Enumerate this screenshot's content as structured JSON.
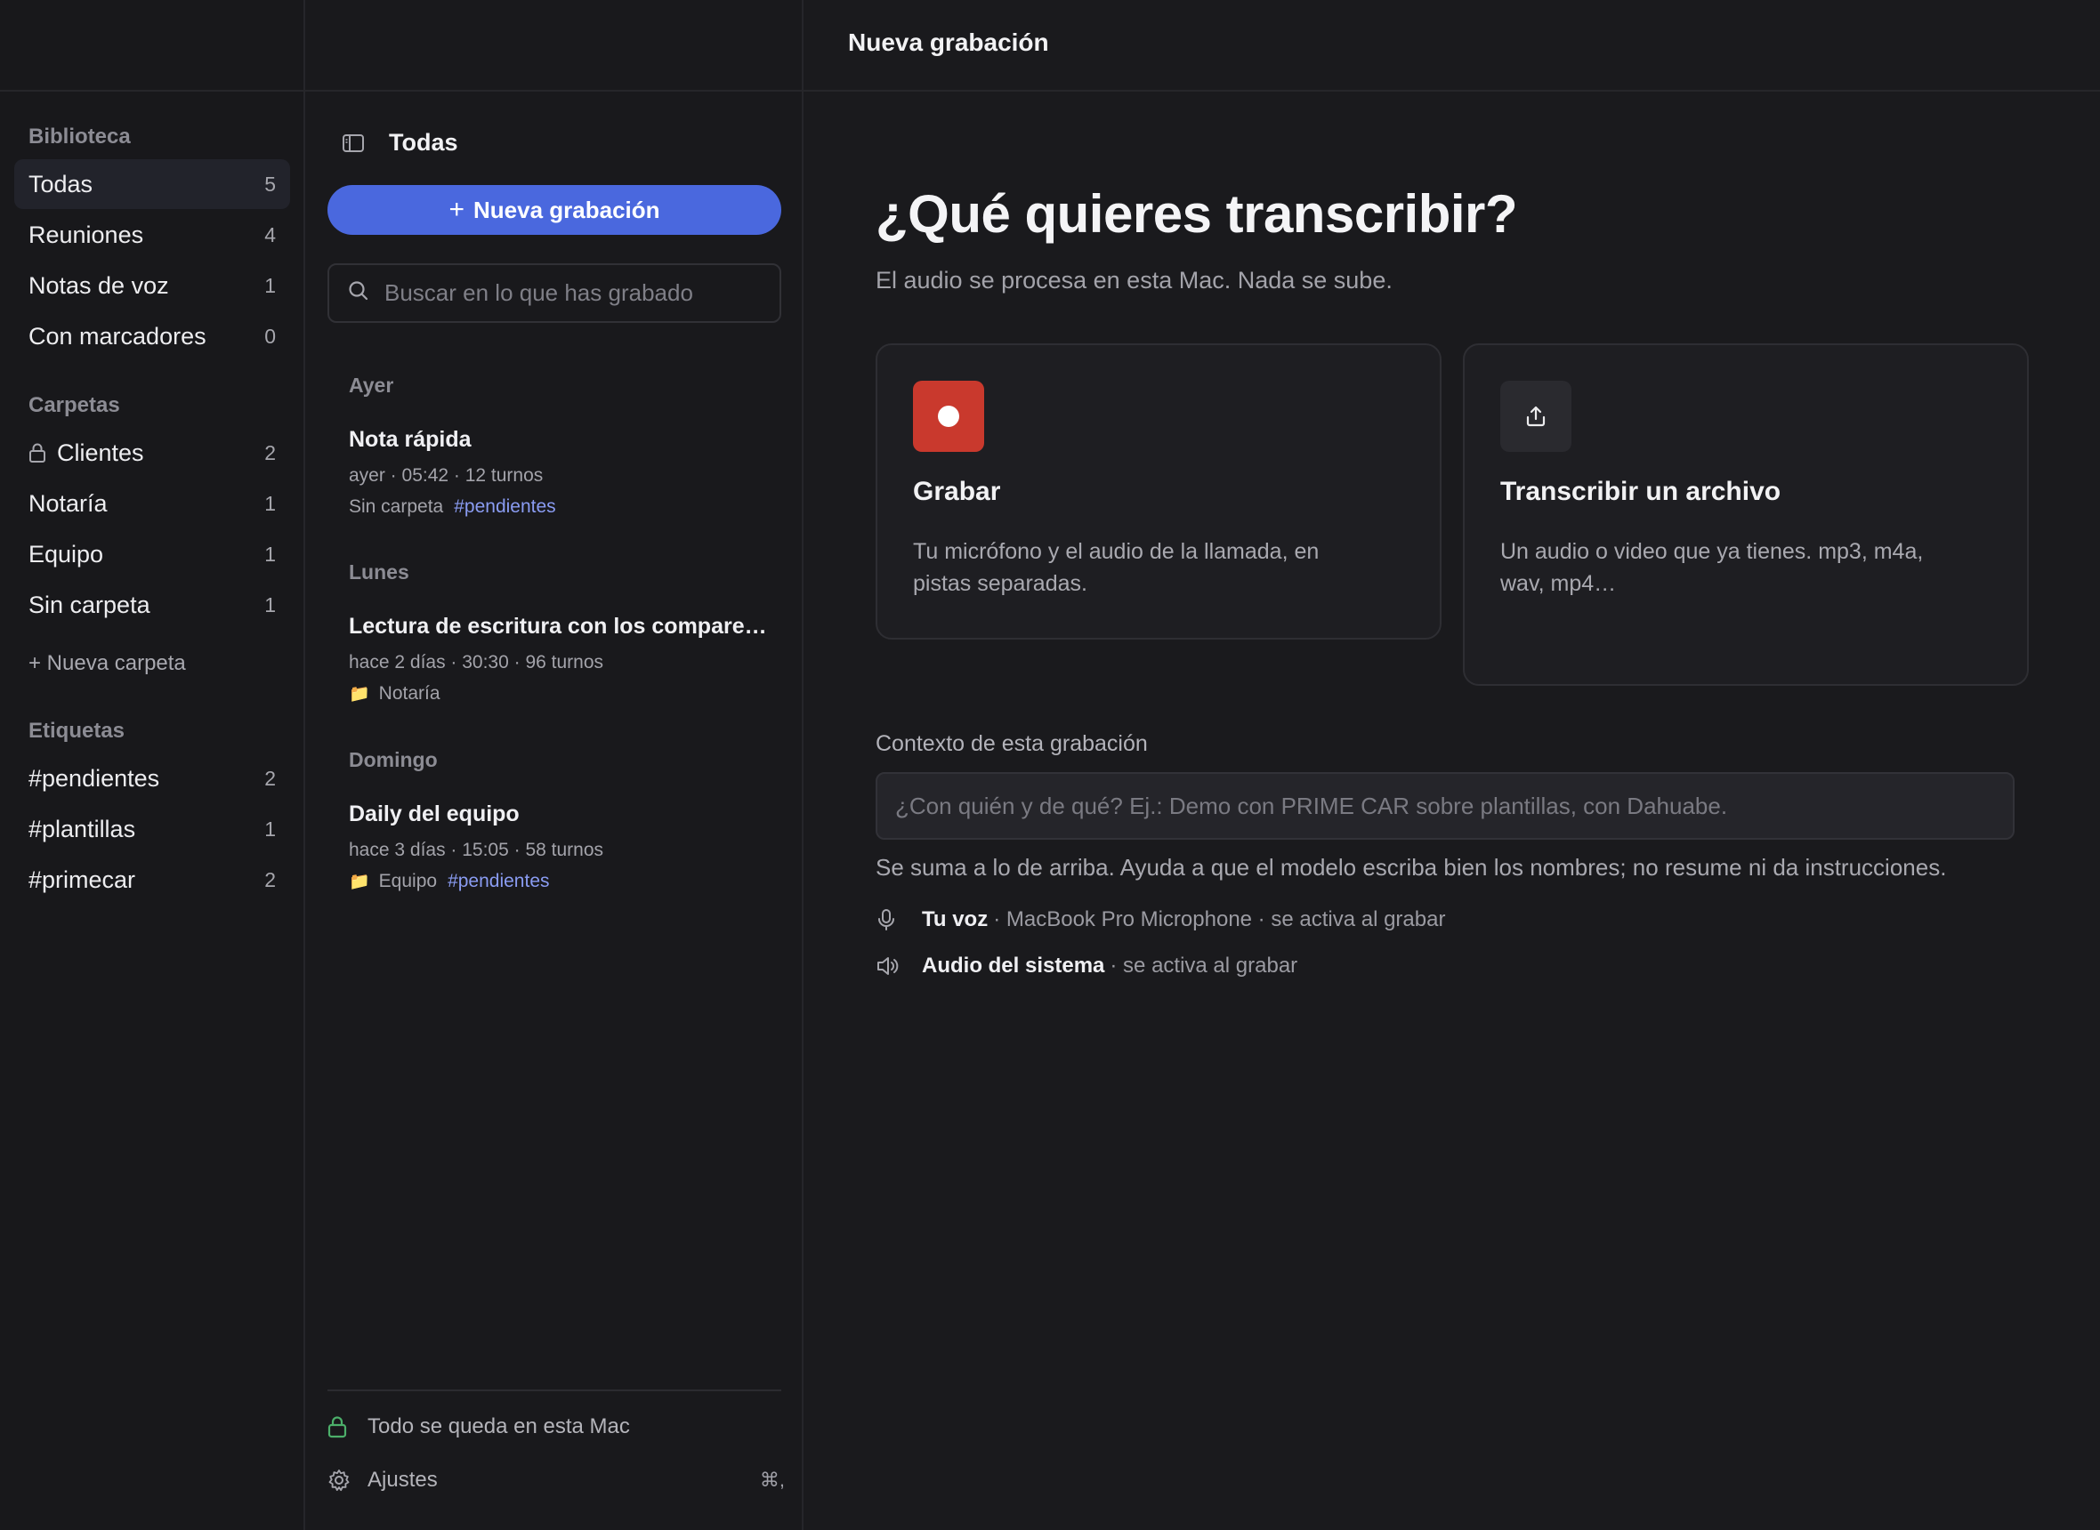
{
  "header": {
    "title": "Nueva grabación"
  },
  "sidebar": {
    "library_label": "Biblioteca",
    "library": [
      {
        "label": "Todas",
        "count": "5"
      },
      {
        "label": "Reuniones",
        "count": "4"
      },
      {
        "label": "Notas de voz",
        "count": "1"
      },
      {
        "label": "Con marcadores",
        "count": "0"
      }
    ],
    "folders_label": "Carpetas",
    "folders": [
      {
        "label": "Clientes",
        "count": "2",
        "icon": "lock-icon"
      },
      {
        "label": "Notaría",
        "count": "1"
      },
      {
        "label": "Equipo",
        "count": "1"
      },
      {
        "label": "Sin carpeta",
        "count": "1"
      }
    ],
    "new_folder": "+ Nueva carpeta",
    "tags_label": "Etiquetas",
    "tags": [
      {
        "label": "#pendientes",
        "count": "2"
      },
      {
        "label": "#plantillas",
        "count": "1"
      },
      {
        "label": "#primecar",
        "count": "2"
      }
    ]
  },
  "list": {
    "title": "Todas",
    "new_button": "Nueva grabación",
    "search_placeholder": "Buscar en lo que has grabado",
    "groups": [
      {
        "day": "Ayer",
        "title": "Nota rápida",
        "meta": "ayer · 05:42 · 12 turnos",
        "folder": "Sin carpeta",
        "tag": "#pendientes"
      },
      {
        "day": "Lunes",
        "title": "Lectura de escritura con los comparecientes",
        "meta": "hace 2 días · 30:30 · 96 turnos",
        "folder": "Notaría",
        "tag": ""
      },
      {
        "day": "Domingo",
        "title": "Daily del equipo",
        "meta": "hace 3 días · 15:05 · 58 turnos",
        "folder": "Equipo",
        "tag": "#pendientes"
      }
    ],
    "footer": {
      "privacy": "Todo se queda en esta Mac",
      "settings": "Ajustes",
      "settings_shortcut": "⌘,"
    }
  },
  "main": {
    "heading": "¿Qué quieres transcribir?",
    "subheading": "El audio se procesa en esta Mac. Nada se sube.",
    "cards": [
      {
        "title": "Grabar",
        "desc": "Tu micrófono y el audio de la llamada, en pistas separadas.",
        "icon": "record-icon"
      },
      {
        "title": "Transcribir un archivo",
        "desc": "Un audio o video que ya tienes. mp3, m4a, wav, mp4…",
        "icon": "upload-icon"
      }
    ],
    "context_label": "Contexto de esta grabación",
    "context_placeholder": "¿Con quién y de qué? Ej.: Demo con PRIME CAR sobre plantillas, con Dahuabe.",
    "context_hint": "Se suma a lo de arriba. Ayuda a que el modelo escriba bien los nombres; no resume ni da instrucciones.",
    "sources": [
      {
        "name": "Tu voz",
        "detail": "· MacBook Pro Microphone · se activa al grabar"
      },
      {
        "name": "Audio del sistema",
        "detail": "· se activa al grabar"
      }
    ]
  },
  "colors": {
    "accent": "#4a68de",
    "record": "#c9392d",
    "tag": "#8a9cf2",
    "lock_green": "#4caf6a"
  }
}
